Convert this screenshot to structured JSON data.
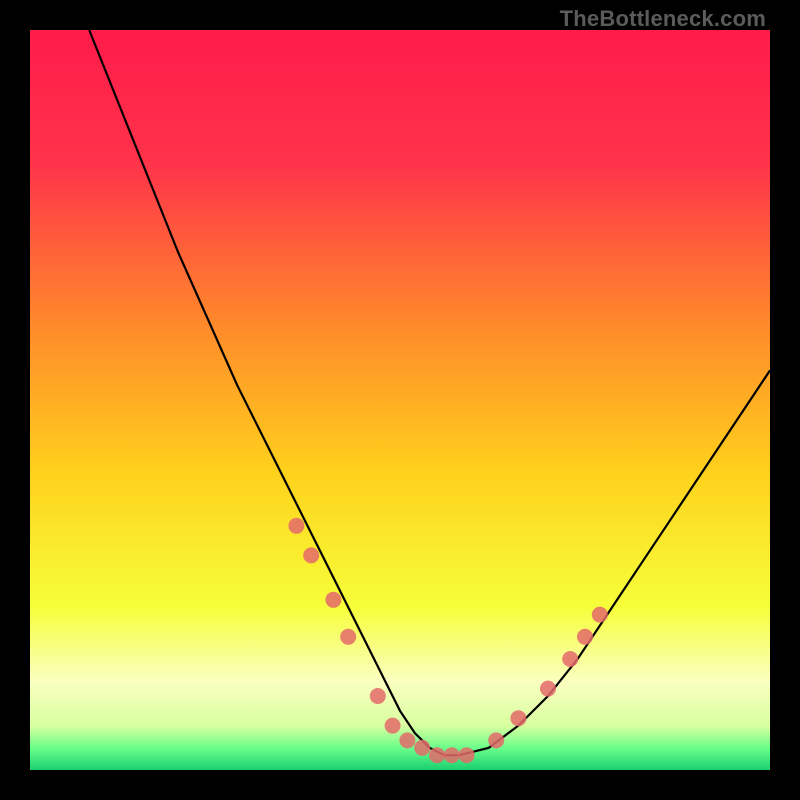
{
  "watermark": "TheBottleneck.com",
  "colors": {
    "top": "#ff1b4a",
    "mid_upper": "#ff7a2f",
    "mid": "#ffd21c",
    "mid_lower": "#f6ff3a",
    "pale": "#faffc0",
    "green": "#21e07a",
    "curve": "#000000",
    "marker": "#e46a6a",
    "frame_bg": "#000000"
  },
  "chart_data": {
    "type": "line",
    "title": "",
    "xlabel": "",
    "ylabel": "",
    "xlim": [
      0,
      100
    ],
    "ylim": [
      0,
      100
    ],
    "series": [
      {
        "name": "bottleneck-curve",
        "x": [
          8,
          12,
          16,
          20,
          24,
          28,
          32,
          36,
          40,
          44,
          46,
          48,
          50,
          52,
          54,
          56,
          58,
          62,
          66,
          70,
          74,
          78,
          82,
          86,
          90,
          94,
          98,
          100
        ],
        "y": [
          100,
          90,
          80,
          70,
          61,
          52,
          44,
          36,
          28,
          20,
          16,
          12,
          8,
          5,
          3,
          2,
          2,
          3,
          6,
          10,
          15,
          21,
          27,
          33,
          39,
          45,
          51,
          54
        ]
      }
    ],
    "markers": [
      {
        "x": 36,
        "y": 33
      },
      {
        "x": 38,
        "y": 29
      },
      {
        "x": 41,
        "y": 23
      },
      {
        "x": 43,
        "y": 18
      },
      {
        "x": 47,
        "y": 10
      },
      {
        "x": 49,
        "y": 6
      },
      {
        "x": 51,
        "y": 4
      },
      {
        "x": 53,
        "y": 3
      },
      {
        "x": 55,
        "y": 2
      },
      {
        "x": 57,
        "y": 2
      },
      {
        "x": 59,
        "y": 2
      },
      {
        "x": 63,
        "y": 4
      },
      {
        "x": 66,
        "y": 7
      },
      {
        "x": 70,
        "y": 11
      },
      {
        "x": 73,
        "y": 15
      },
      {
        "x": 75,
        "y": 18
      },
      {
        "x": 77,
        "y": 21
      }
    ],
    "gradient_stops": [
      {
        "offset": 0.0,
        "color": "#ff1b4a"
      },
      {
        "offset": 0.18,
        "color": "#ff334a"
      },
      {
        "offset": 0.4,
        "color": "#ff8a2a"
      },
      {
        "offset": 0.6,
        "color": "#ffd21c"
      },
      {
        "offset": 0.78,
        "color": "#f6ff3a"
      },
      {
        "offset": 0.88,
        "color": "#faffc0"
      },
      {
        "offset": 0.94,
        "color": "#d9ffa0"
      },
      {
        "offset": 0.97,
        "color": "#6bff8a"
      },
      {
        "offset": 1.0,
        "color": "#19d070"
      }
    ]
  }
}
